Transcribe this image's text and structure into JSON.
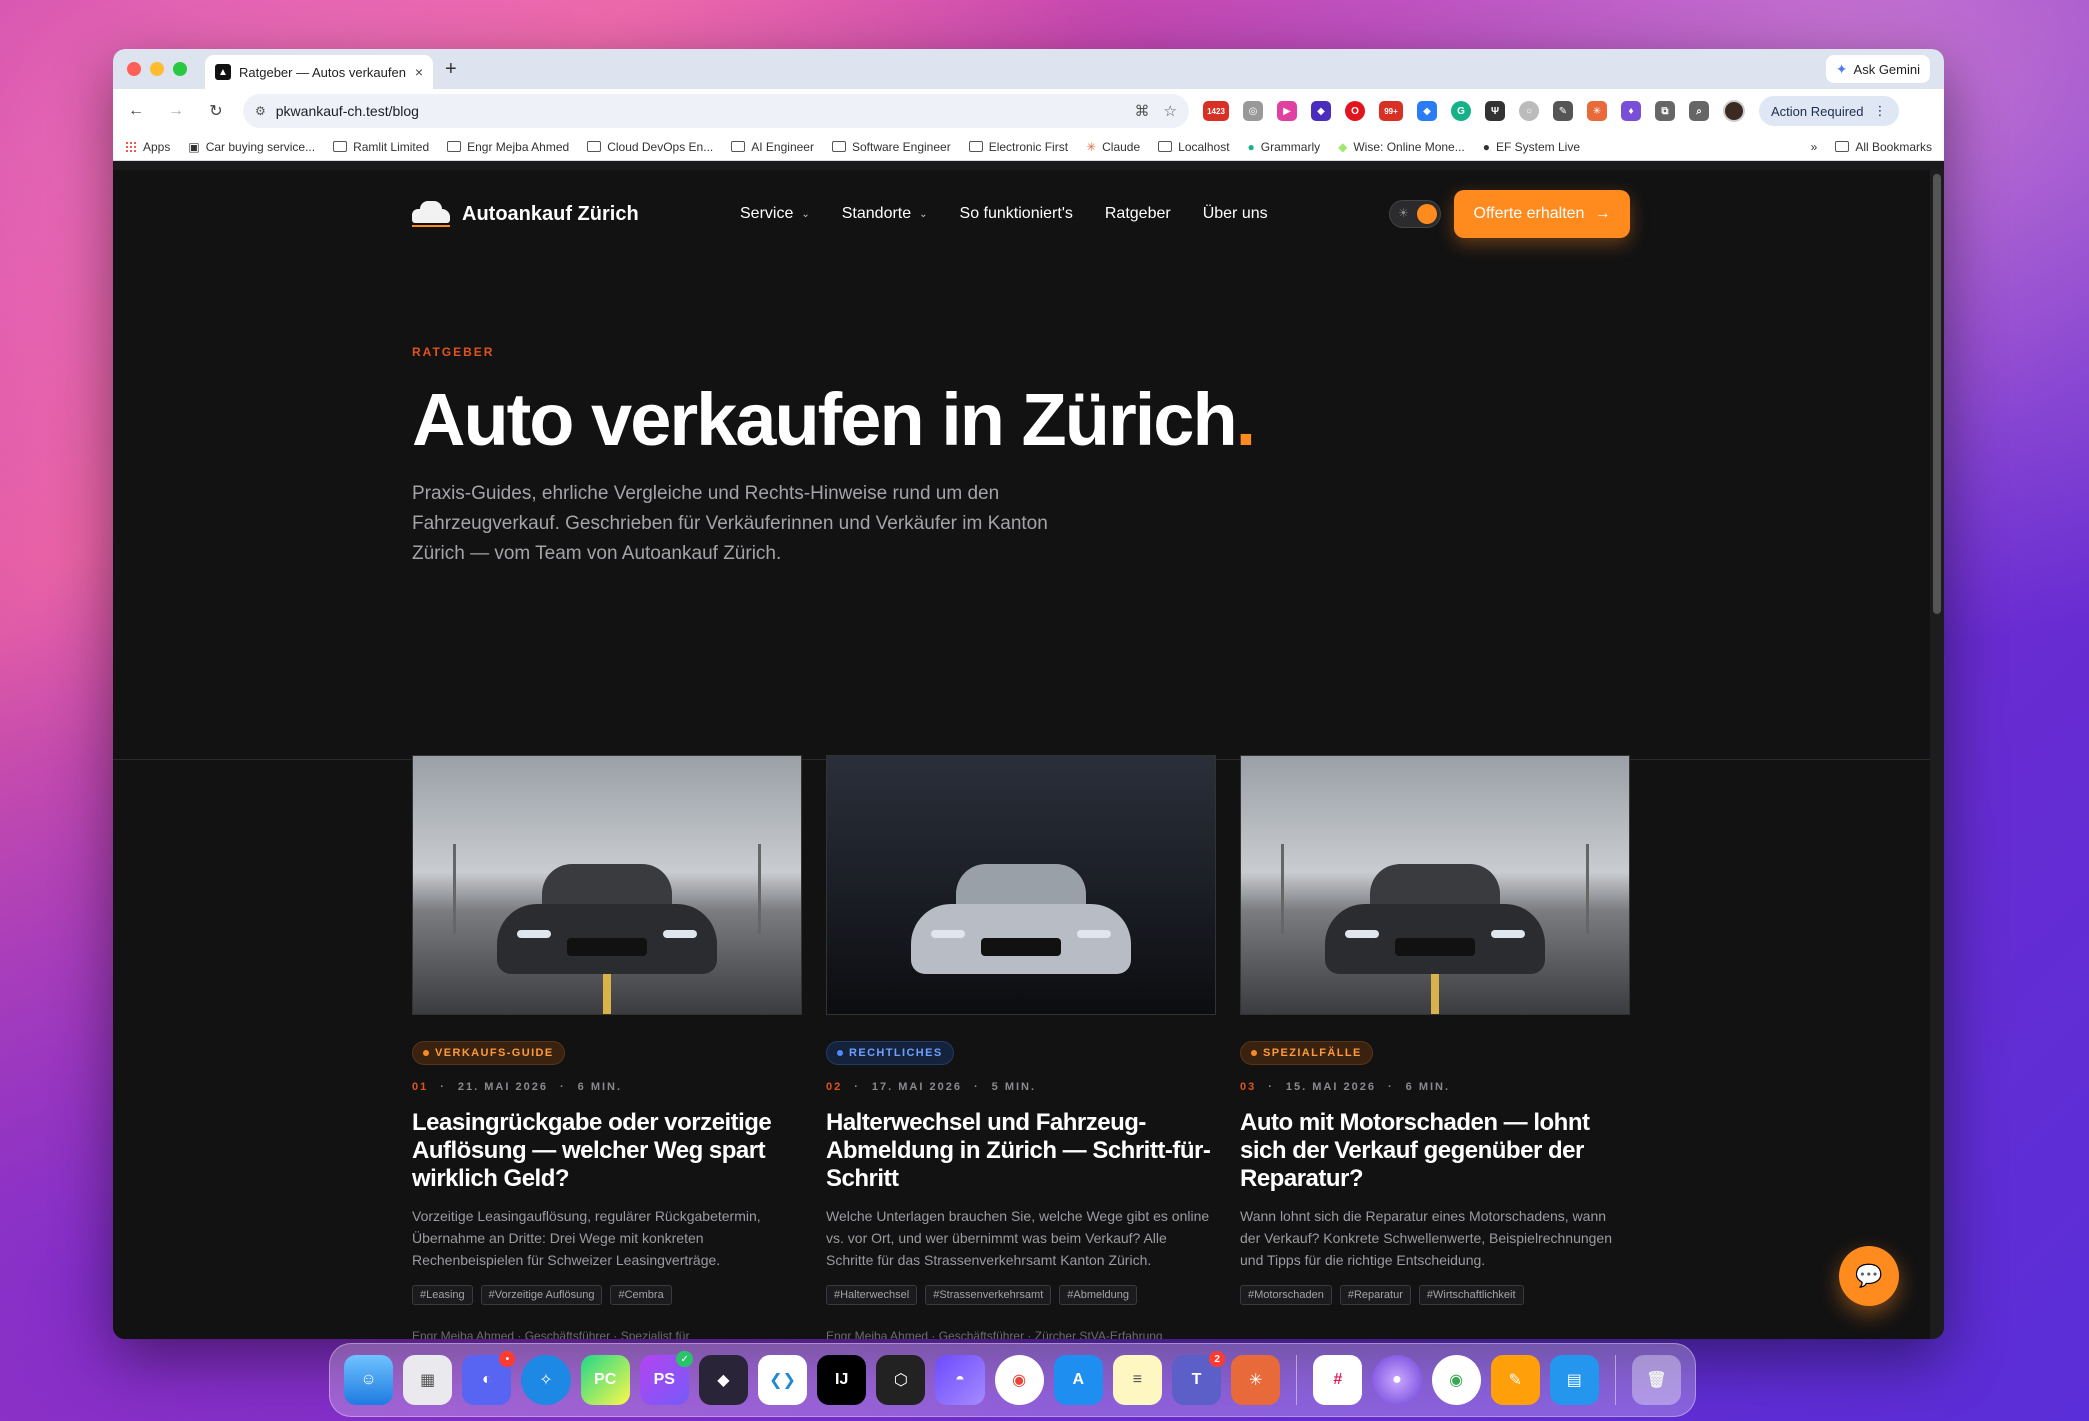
{
  "browser": {
    "tab_title": "Ratgeber — Autos verkaufen",
    "tab_close": "×",
    "new_tab": "+",
    "gemini_label": "Ask Gemini",
    "url": "pkwankauf-ch.test/blog",
    "action_required": "Action Required",
    "ext_badge_1": "1423",
    "ext_badge_2": "99+",
    "bookmarks": [
      "Apps",
      "Car buying service...",
      "Ramlit Limited",
      "Engr Mejba Ahmed",
      "Cloud DevOps En...",
      "AI Engineer",
      "Software Engineer",
      "Electronic First",
      "Claude",
      "Localhost",
      "Grammarly",
      "Wise: Online Mone...",
      "EF System Live"
    ],
    "bookmarks_more": "»",
    "all_bookmarks": "All Bookmarks"
  },
  "site": {
    "brand": "Autoankauf Zürich",
    "nav": [
      "Service",
      "Standorte",
      "So funktioniert's",
      "Ratgeber",
      "Über uns"
    ],
    "cta": "Offerte erhalten"
  },
  "hero": {
    "eyebrow": "RATGEBER",
    "title": "Auto verkaufen in Zürich",
    "title_dot": ".",
    "lead": "Praxis-Guides, ehrliche Vergleiche und Rechts-Hinweise rund um den Fahrzeugverkauf. Geschrieben für Verkäuferinnen und Verkäufer im Kanton Zürich — vom Team von Autoankauf Zürich."
  },
  "articles": [
    {
      "category": "VERKAUFS-GUIDE",
      "number": "01",
      "date": "21. MAI 2026",
      "read": "6 MIN.",
      "title": "Leasingrückgabe oder vorzeitige Auflösung — welcher Weg spart wirklich Geld?",
      "excerpt": "Vorzeitige Leasingauflösung, regulärer Rückgabetermin, Übernahme an Dritte: Drei Wege mit konkreten Rechenbeispielen für Schweizer Leasingverträge.",
      "tags": [
        "#Leasing",
        "#Vorzeitige Auflösung",
        "#Cembra"
      ],
      "author": "Engr Mejba Ahmed · Geschäftsführer · Spezialist für"
    },
    {
      "category": "RECHTLICHES",
      "number": "02",
      "date": "17. MAI 2026",
      "read": "5 MIN.",
      "title": "Halterwechsel und Fahrzeug-Abmeldung in Zürich — Schritt-für-Schritt",
      "excerpt": "Welche Unterlagen brauchen Sie, welche Wege gibt es online vs. vor Ort, und wer übernimmt was beim Verkauf? Alle Schritte für das Strassenverkehrsamt Kanton Zürich.",
      "tags": [
        "#Halterwechsel",
        "#Strassenverkehrsamt",
        "#Abmeldung"
      ],
      "author": "Engr Mejba Ahmed · Geschäftsführer · Zürcher StVA-Erfahrung"
    },
    {
      "category": "SPEZIALFÄLLE",
      "number": "03",
      "date": "15. MAI 2026",
      "read": "6 MIN.",
      "title": "Auto mit Motorschaden — lohnt sich der Verkauf gegenüber der Reparatur?",
      "excerpt": "Wann lohnt sich die Reparatur eines Motorschadens, wann der Verkauf? Konkrete Schwellenwerte, Beispielrechnungen und Tipps für die richtige Entscheidung.",
      "tags": [
        "#Motorschaden",
        "#Reparatur",
        "#Wirtschaftlichkeit"
      ],
      "author": ""
    }
  ],
  "meta_sep": "·",
  "dock": {
    "apps": [
      "Finder",
      "Launchpad",
      "Discord",
      "Safari",
      "PyCharm",
      "PhpStorm",
      "Obsidian",
      "VS Code",
      "IntelliJ",
      "Cursor",
      "Proton",
      "Chrome",
      "App Store",
      "Notes",
      "Teams",
      "Claude",
      "Slack",
      "Orb",
      "Chrome",
      "Pages",
      "Docker",
      "Trash"
    ],
    "discord_badge": "•",
    "teams_badge": "2"
  },
  "colors": {
    "accent": "#ff8a1e",
    "eyebrow": "#e0531f",
    "page_bg": "#121213"
  }
}
